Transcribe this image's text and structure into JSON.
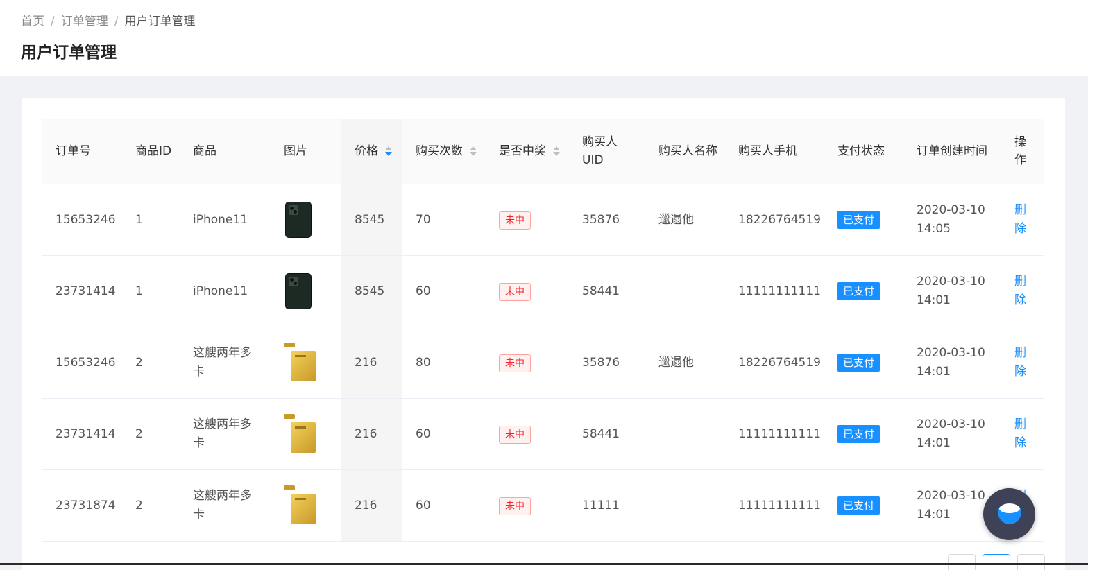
{
  "breadcrumb": {
    "home": "首页",
    "section": "订单管理",
    "current": "用户订单管理"
  },
  "page_title": "用户订单管理",
  "table": {
    "headers": {
      "order_no": "订单号",
      "product_id": "商品ID",
      "product": "商品",
      "image": "图片",
      "price": "价格",
      "purchase_count": "购买次数",
      "won": "是否中奖",
      "buyer_uid": "购买人UID",
      "buyer_name": "购买人名称",
      "buyer_phone": "购买人手机",
      "pay_status": "支付状态",
      "created_at": "订单创建时间",
      "action": "操作"
    },
    "rows": [
      {
        "order_no": "15653246",
        "product_id": "1",
        "product": "iPhone11",
        "image": "iphone-image",
        "price": "8545",
        "count": "70",
        "won": "未中",
        "uid": "35876",
        "name": "邋遢他",
        "phone": "18226764519",
        "status": "已支付",
        "date": "2020-03-10",
        "time": "14:05",
        "action": "删除"
      },
      {
        "order_no": "23731414",
        "product_id": "1",
        "product": "iPhone11",
        "image": "iphone-image",
        "price": "8545",
        "count": "60",
        "won": "未中",
        "uid": "58441",
        "name": "",
        "phone": "11111111111",
        "status": "已支付",
        "date": "2020-03-10",
        "time": "14:01",
        "action": "删除"
      },
      {
        "order_no": "15653246",
        "product_id": "2",
        "product": "这艘两年多卡",
        "image": "gold-bar-image",
        "price": "216",
        "count": "80",
        "won": "未中",
        "uid": "35876",
        "name": "邋遢他",
        "phone": "18226764519",
        "status": "已支付",
        "date": "2020-03-10",
        "time": "14:01",
        "action": "删除"
      },
      {
        "order_no": "23731414",
        "product_id": "2",
        "product": "这艘两年多卡",
        "image": "gold-bar-image",
        "price": "216",
        "count": "60",
        "won": "未中",
        "uid": "58441",
        "name": "",
        "phone": "11111111111",
        "status": "已支付",
        "date": "2020-03-10",
        "time": "14:01",
        "action": "删除"
      },
      {
        "order_no": "23731874",
        "product_id": "2",
        "product": "这艘两年多卡",
        "image": "gold-bar-image",
        "price": "216",
        "count": "60",
        "won": "未中",
        "uid": "11111",
        "name": "",
        "phone": "11111111111",
        "status": "已支付",
        "date": "2020-03-10",
        "time": "14:01",
        "action": "删除"
      }
    ]
  },
  "colors": {
    "primary": "#1890ff",
    "danger": "#f5222d",
    "background": "#f0f2f5"
  },
  "icons": {
    "sort": "sort-caret-icon",
    "float_button": "rice-bowl-icon"
  }
}
